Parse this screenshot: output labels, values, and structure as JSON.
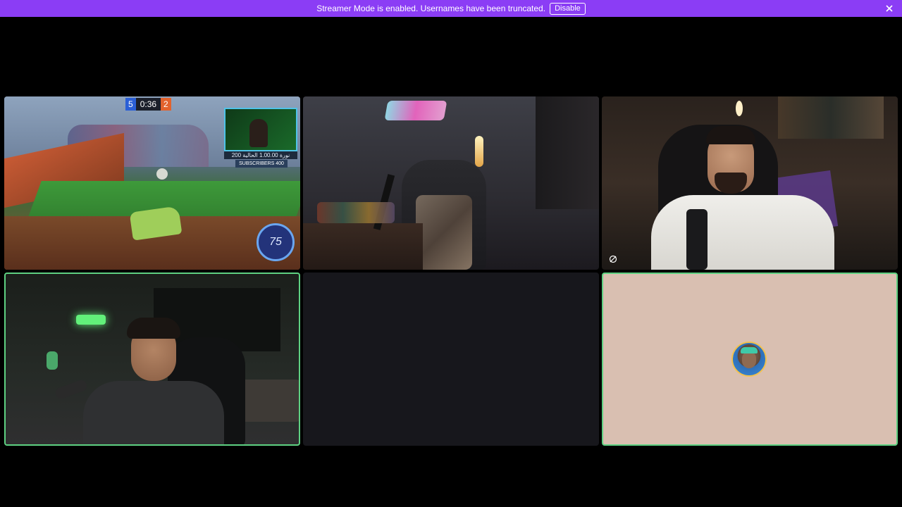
{
  "banner": {
    "message": "Streamer Mode is enabled. Usernames have been truncated.",
    "disable_label": "Disable",
    "background": "#8b3df5"
  },
  "game_tile": {
    "score_left": "5",
    "timer": "0:36",
    "score_right": "2",
    "cam_overlay_line": "نورة 1.00.00 الحالية 200",
    "subscribers": "SUBSCRIBERS 400",
    "boost": "75"
  },
  "colors": {
    "speaking_border": "#5ed182",
    "background": "#000000",
    "empty_tile": "#17171c",
    "avatar_tile": "#d9bfb1"
  },
  "icons": {
    "banner_close": "close-icon",
    "muted_camera": "camera-off-icon"
  }
}
